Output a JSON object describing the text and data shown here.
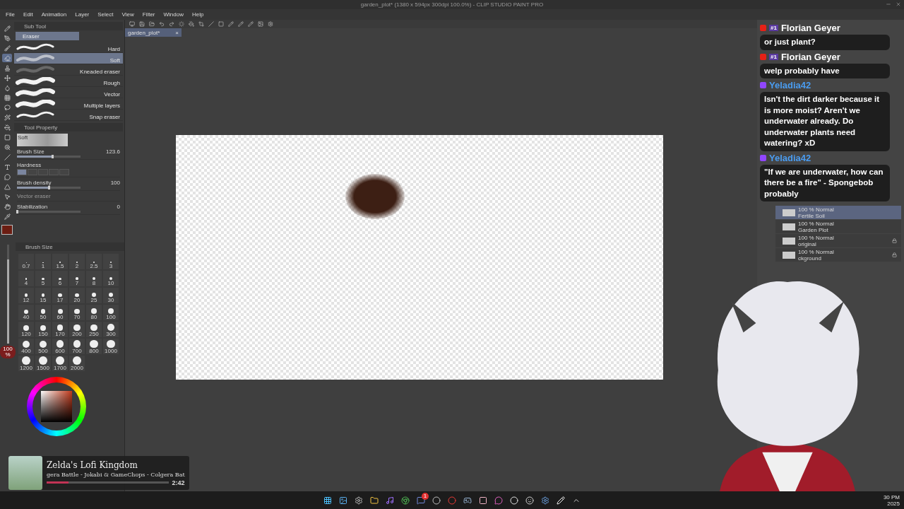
{
  "window": {
    "title": "garden_plot* (1380 x 594px 300dpi 100.0%) - CLIP STUDIO PAINT PRO"
  },
  "menu": [
    "File",
    "Edit",
    "Animation",
    "Layer",
    "Select",
    "View",
    "Filter",
    "Window",
    "Help"
  ],
  "document_tab": {
    "label": "garden_plot*",
    "close": "×"
  },
  "tools": [
    {
      "kind": "pencil",
      "selected": false
    },
    {
      "kind": "pen",
      "selected": false
    },
    {
      "kind": "brush",
      "selected": false
    },
    {
      "kind": "eraser",
      "selected": true
    },
    {
      "kind": "stamp",
      "selected": false
    },
    {
      "kind": "move",
      "selected": false
    },
    {
      "kind": "fill",
      "selected": false
    },
    {
      "kind": "grid",
      "selected": false
    },
    {
      "kind": "lasso",
      "selected": false
    },
    {
      "kind": "wand",
      "selected": false
    },
    {
      "kind": "bucket",
      "selected": false
    },
    {
      "kind": "gradient",
      "selected": false
    },
    {
      "kind": "zoom",
      "selected": false
    },
    {
      "kind": "line",
      "selected": false
    },
    {
      "kind": "text",
      "selected": false
    },
    {
      "kind": "balloon",
      "selected": false
    },
    {
      "kind": "ruler",
      "selected": false
    },
    {
      "kind": "pointer",
      "selected": false
    },
    {
      "kind": "hand",
      "selected": false
    },
    {
      "kind": "eyedropper",
      "selected": false
    }
  ],
  "sub_tool": {
    "title": "Sub Tool",
    "group": "Eraser",
    "items": [
      {
        "label": "Hard",
        "kind": "thin",
        "selected": false
      },
      {
        "label": "Soft",
        "kind": "soft",
        "selected": true
      },
      {
        "label": "Kneaded eraser",
        "kind": "faint",
        "selected": false
      },
      {
        "label": "Rough",
        "kind": "thick",
        "selected": false
      },
      {
        "label": "Vector",
        "kind": "thick",
        "selected": false
      },
      {
        "label": "Multiple layers",
        "kind": "thick",
        "selected": false
      },
      {
        "label": "Snap eraser",
        "kind": "thin",
        "selected": false
      }
    ]
  },
  "tool_property": {
    "title": "Tool Property",
    "preview_label": "Soft",
    "rows": [
      {
        "kind": "slider",
        "label": "Brush Size",
        "value": "123.6",
        "level": 0.55,
        "disabled": false
      },
      {
        "kind": "steps",
        "label": "Hardness",
        "level": 0.2,
        "disabled": false
      },
      {
        "kind": "slider",
        "label": "Brush density",
        "value": "100",
        "level": 0.5,
        "disabled": false
      },
      {
        "kind": "plain",
        "label": "Vector eraser",
        "disabled": true
      },
      {
        "kind": "slider",
        "label": "Stabilization",
        "value": "0",
        "level": 0.0,
        "disabled": false
      }
    ]
  },
  "size_slider": {
    "reading": "100 %",
    "level": 0.85
  },
  "brush_size": {
    "title": "Brush Size",
    "sizes": [
      "0.7",
      "1",
      "1.5",
      "2",
      "2.5",
      "3",
      "4",
      "5",
      "6",
      "7",
      "8",
      "10",
      "12",
      "15",
      "17",
      "20",
      "25",
      "30",
      "40",
      "50",
      "60",
      "70",
      "80",
      "100",
      "120",
      "150",
      "170",
      "200",
      "250",
      "300",
      "400",
      "500",
      "600",
      "700",
      "800",
      "1000",
      "1200",
      "1500",
      "1700",
      "2000"
    ]
  },
  "chat": [
    {
      "kind": "youtube",
      "badge": "#1",
      "name": "Florian Geyer",
      "color": "#ffffff",
      "message": "or just plant?"
    },
    {
      "kind": "youtube",
      "badge": "#1",
      "name": "Florian Geyer",
      "color": "#ffffff",
      "message": "welp probably have"
    },
    {
      "kind": "twitch",
      "name": "Yeladia42",
      "color": "#4a9cf0",
      "message": "Isn't the dirt darker because it is more moist? Aren't we underwater already. Do underwater plants need watering? xD"
    },
    {
      "kind": "twitch",
      "name": "Yeladia42",
      "color": "#4a9cf0",
      "message": "\"If we are underwater, how can there be a fire\" - Spongebob probably"
    }
  ],
  "layers": [
    {
      "mode": "100 % Normal",
      "name": "Fertile Soil",
      "selected": true,
      "locked": false
    },
    {
      "mode": "100 % Normal",
      "name": "Garden Plot",
      "selected": false,
      "locked": false
    },
    {
      "mode": "100 % Normal",
      "name": "original",
      "selected": false,
      "locked": true
    },
    {
      "mode": "100 % Normal",
      "name": "ckground",
      "selected": false,
      "locked": true
    }
  ],
  "now_playing": {
    "title": "Zelda's Lofi Kingdom",
    "track": "gera Battle - Jokabi & GameChops - Colgera Bat",
    "level": 0.18,
    "time": "2:42"
  },
  "taskbar": {
    "notification_count": "1",
    "clock": [
      "30 PM",
      "2025"
    ]
  }
}
